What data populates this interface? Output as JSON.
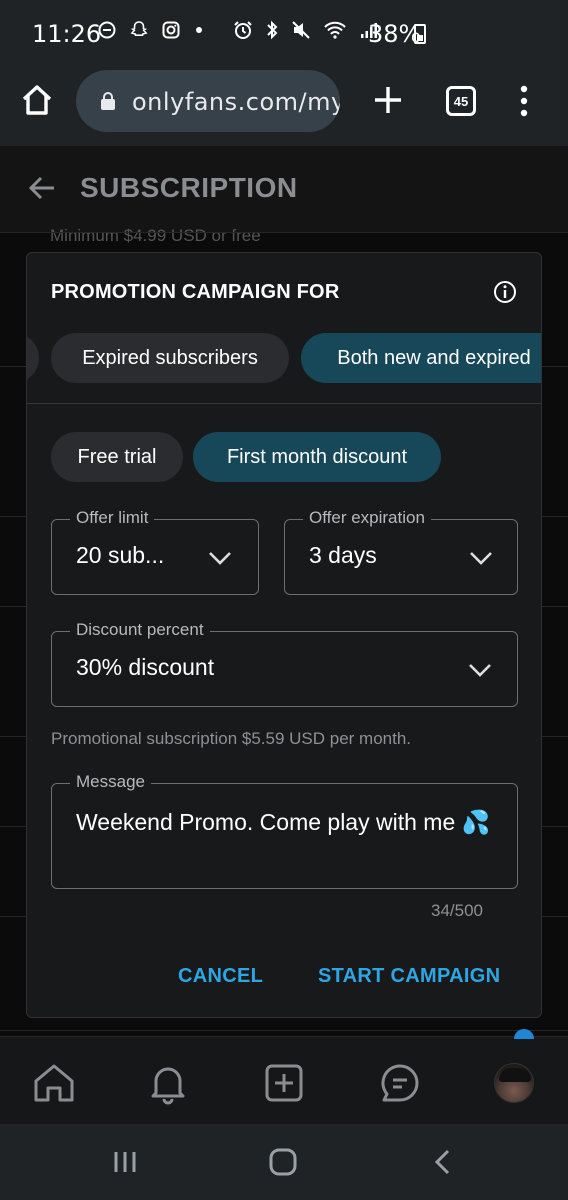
{
  "status_bar": {
    "time": "11:26",
    "battery": "38%",
    "icons": [
      "do-not-disturb-icon",
      "snapchat-icon",
      "instagram-icon",
      "dot-icon",
      "alarm-icon",
      "bluetooth-icon",
      "mute-icon",
      "wifi-icon",
      "signal-icon",
      "battery-icon"
    ]
  },
  "browser": {
    "url": "onlyfans.com/my",
    "tab_count": "45"
  },
  "page": {
    "title": "SUBSCRIPTION",
    "peek_text": "Minimum $4.99 USD or free"
  },
  "dialog": {
    "title": "PROMOTION CAMPAIGN FOR",
    "audience_chips": [
      {
        "label": "Expired subscribers",
        "selected": false
      },
      {
        "label": "Both new and expired",
        "selected": true
      }
    ],
    "type_chips": [
      {
        "label": "Free trial",
        "selected": false
      },
      {
        "label": "First month discount",
        "selected": true
      }
    ],
    "offer_limit": {
      "label": "Offer limit",
      "value": "20 sub..."
    },
    "offer_expiration": {
      "label": "Offer expiration",
      "value": "3 days"
    },
    "discount_percent": {
      "label": "Discount percent",
      "value": "30% discount"
    },
    "helper_text": "Promotional subscription $5.59 USD per month.",
    "message": {
      "label": "Message",
      "value": "Weekend Promo. Come play with me 💦"
    },
    "counter": "34/500",
    "cancel_label": "CANCEL",
    "start_label": "START CAMPAIGN"
  },
  "colors": {
    "accent": "#2fa6e3",
    "selected_chip": "#17485a",
    "chip": "#2b2c2f",
    "dialog_bg": "#18191b"
  }
}
